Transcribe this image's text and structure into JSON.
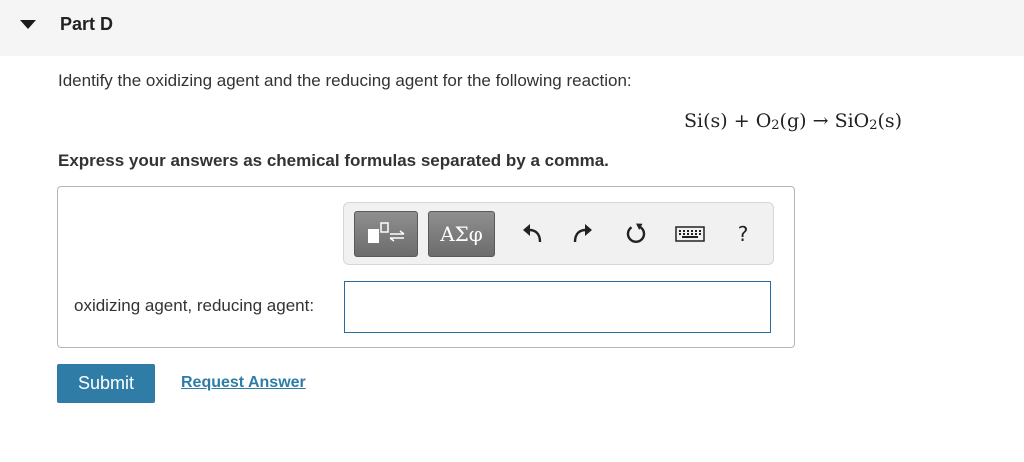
{
  "part": {
    "title": "Part D"
  },
  "question": {
    "prompt": "Identify the oxidizing agent and the reducing agent for the following reaction:",
    "equation": {
      "reactant1": "Si(s)",
      "plus": "+",
      "reactant2_base": "O",
      "reactant2_sub": "2",
      "reactant2_state": "(g)",
      "arrow": "→",
      "product_base": "SiO",
      "product_sub": "2",
      "product_state": "(s)"
    },
    "instruction": "Express your answers as chemical formulas separated by a comma."
  },
  "toolbar": {
    "symbols_label": "ΑΣφ",
    "help_label": "?",
    "icons": [
      "templates-icon",
      "undo-icon",
      "redo-icon",
      "reset-icon",
      "keyboard-icon",
      "help-icon"
    ]
  },
  "answer": {
    "field_label": "oxidizing agent, reducing agent:",
    "value": "",
    "placeholder": ""
  },
  "actions": {
    "submit_label": "Submit",
    "request_label": "Request Answer"
  },
  "colors": {
    "accent": "#2f7da6",
    "header_bg": "#f5f5f5",
    "input_border": "#2a6b9c"
  }
}
